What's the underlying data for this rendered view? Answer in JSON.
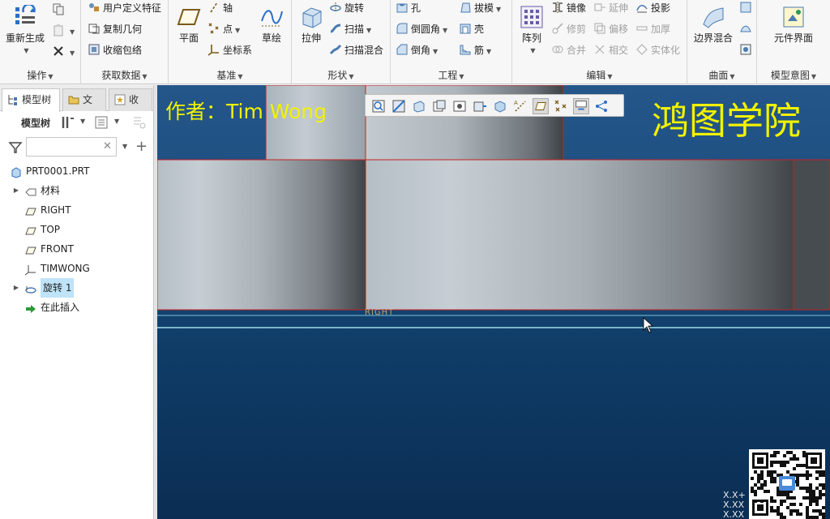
{
  "ribbon": {
    "groups": {
      "operations": "操作",
      "get_data": "获取数据",
      "datum": "基准",
      "shapes": "形状",
      "engineering": "工程",
      "editing": "编辑",
      "surfaces": "曲面",
      "model_intent": "模型意图"
    },
    "buttons": {
      "regenerate": "重新生成",
      "user_defined_feature": "用户定义特征",
      "copy_geometry": "复制几何",
      "shrinkwrap": "收缩包络",
      "plane": "平面",
      "axis": "轴",
      "point": "点",
      "coord_sys": "坐标系",
      "sketch": "草绘",
      "extrude": "拉伸",
      "revolve": "旋转",
      "sweep": "扫描",
      "swept_blend": "扫描混合",
      "hole": "孔",
      "round": "倒圆角",
      "chamfer": "倒角",
      "draft": "拔模",
      "shell": "壳",
      "rib": "筋",
      "pattern": "阵列",
      "mirror": "镜像",
      "extend": "延伸",
      "project": "投影",
      "trim": "修剪",
      "offset": "偏移",
      "thicken": "加厚",
      "merge": "合并",
      "intersect": "相交",
      "solidify": "实体化",
      "boundary_blend": "边界混合",
      "component_interface": "元件界面"
    }
  },
  "left_panel": {
    "tabs": [
      "模型树",
      "文",
      "收"
    ],
    "tree_label": "模型树",
    "filter_placeholder": "",
    "tree": [
      {
        "label": "PRT0001.PRT",
        "icon": "part-icon",
        "expandable": false
      },
      {
        "label": "材料",
        "icon": "material-icon",
        "expandable": true
      },
      {
        "label": "RIGHT",
        "icon": "datum-plane-icon",
        "expandable": false
      },
      {
        "label": "TOP",
        "icon": "datum-plane-icon",
        "expandable": false
      },
      {
        "label": "FRONT",
        "icon": "datum-plane-icon",
        "expandable": false
      },
      {
        "label": "TIMWONG",
        "icon": "coord-system-icon",
        "expandable": false
      },
      {
        "label": "旋转 1",
        "icon": "revolve-icon",
        "expandable": true,
        "selected": true
      },
      {
        "label": "在此插入",
        "icon": "insert-here-icon",
        "expandable": false
      }
    ]
  },
  "viewport": {
    "author_text": "作者：Tim Wong",
    "brand_text": "鸿图学院",
    "datum_label": "RIGHT",
    "coord_readout": [
      "X.X+",
      "X.XX",
      "X.XX"
    ]
  },
  "colors": {
    "overlay_text": "#f2f200",
    "edge_red": "#d01818",
    "selection": "#bfe3f8"
  }
}
